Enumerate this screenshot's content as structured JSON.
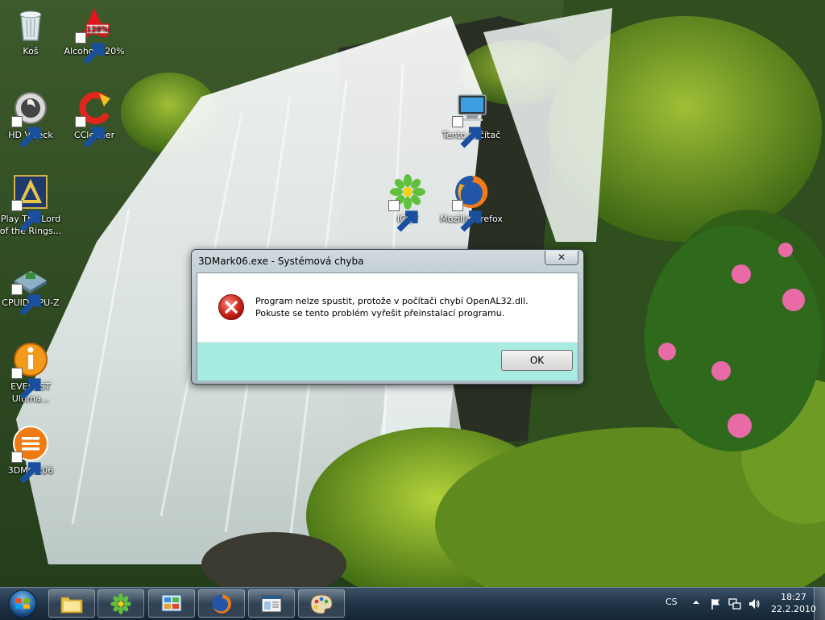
{
  "desktop": {
    "icons": [
      {
        "label": "Koš",
        "icon": "recycle-bin-icon"
      },
      {
        "label": "Alcohol 120%",
        "icon": "alcohol-120-icon",
        "badge": "120%"
      },
      {
        "label": "HD VDeck",
        "icon": "hd-vdeck-icon"
      },
      {
        "label": "CCleaner",
        "icon": "ccleaner-icon"
      },
      {
        "label": "Play The Lord of the Rings...",
        "icon": "lotro-icon"
      },
      {
        "label": "CPUID CPU-Z",
        "icon": "cpuz-icon"
      },
      {
        "label": "EVEREST Ultima...",
        "icon": "everest-icon"
      },
      {
        "label": "3DMark06",
        "icon": "3dmark-icon"
      },
      {
        "label": "Tento Počítač",
        "icon": "computer-icon"
      },
      {
        "label": "ICQ7",
        "icon": "icq-icon"
      },
      {
        "label": "Mozilla Firefox",
        "icon": "firefox-icon"
      }
    ]
  },
  "dialog": {
    "title": "3DMark06.exe - Systémová chyba",
    "close_glyph": "✕",
    "message": "Program nelze spustit, protože v počítači chybí OpenAL32.dll. Pokuste se tento problém vyřešit přeinstalací programu.",
    "ok_label": "OK",
    "button_area_color": "#a8ebe1"
  },
  "taskbar": {
    "pinned": [
      {
        "name": "explorer",
        "icon": "folder-icon"
      },
      {
        "name": "icq",
        "icon": "icq-icon"
      },
      {
        "name": "control-panel",
        "icon": "control-panel-icon"
      },
      {
        "name": "firefox",
        "icon": "firefox-icon"
      },
      {
        "name": "window-app",
        "icon": "window-icon"
      },
      {
        "name": "paint",
        "icon": "paint-palette-icon"
      }
    ],
    "language": "CS",
    "time": "18:27",
    "date": "22.2.2010"
  }
}
